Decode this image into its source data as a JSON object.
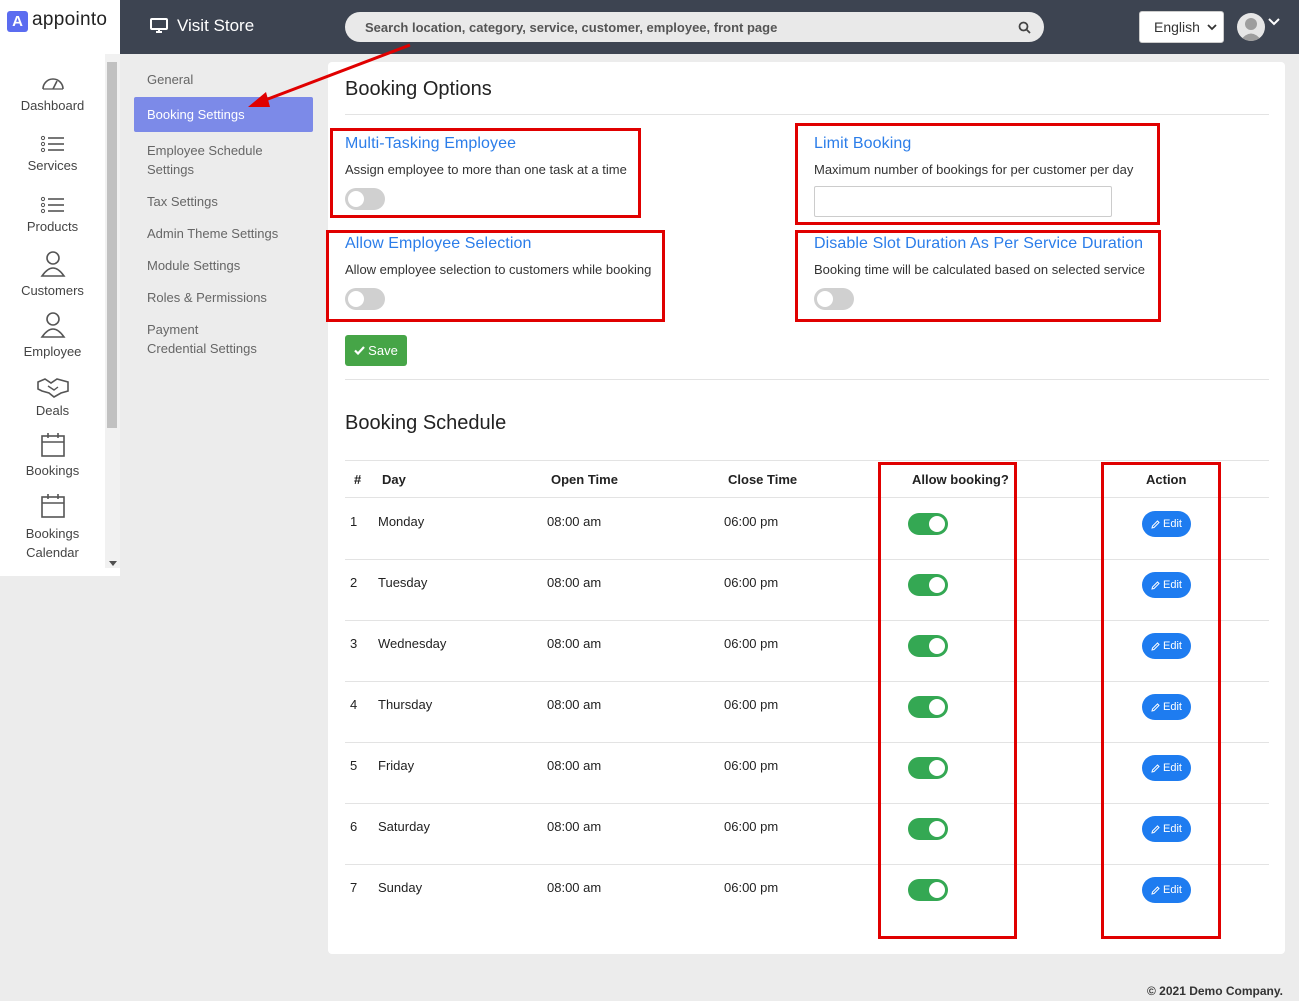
{
  "app": {
    "name": "appointo",
    "logo_letter": "A"
  },
  "topbar": {
    "visit_store": "Visit Store",
    "search_placeholder": "Search location, category, service, customer, employee, front page",
    "language": "English"
  },
  "sidebar": {
    "items": [
      {
        "label": "Dashboard",
        "icon": "dashboard-gauge-icon"
      },
      {
        "label": "Services",
        "icon": "list-icon"
      },
      {
        "label": "Products",
        "icon": "list-icon"
      },
      {
        "label": "Customers",
        "icon": "user-icon"
      },
      {
        "label": "Employee",
        "icon": "user-icon"
      },
      {
        "label": "Deals",
        "icon": "handshake-icon"
      },
      {
        "label": "Bookings",
        "icon": "calendar-icon"
      },
      {
        "label": "Bookings Calendar",
        "icon": "calendar-icon"
      }
    ]
  },
  "settings_menu": [
    "General",
    "Booking Settings",
    "Employee Schedule Settings",
    "Tax Settings",
    "Admin Theme Settings",
    "Module Settings",
    "Roles & Permissions",
    "Payment Credential Settings"
  ],
  "booking_options": {
    "title": "Booking Options",
    "multi_tasking": {
      "title": "Multi-Tasking Employee",
      "desc": "Assign employee to more than one task at a time"
    },
    "limit_booking": {
      "title": "Limit Booking",
      "desc": "Maximum number of bookings for per customer per day",
      "value": ""
    },
    "employee_selection": {
      "title": "Allow Employee Selection",
      "desc": "Allow employee selection to customers while booking"
    },
    "disable_slot": {
      "title": "Disable Slot Duration As Per Service Duration",
      "desc": "Booking time will be calculated based on selected service"
    },
    "save_label": "Save"
  },
  "booking_schedule": {
    "title": "Booking Schedule",
    "columns": {
      "num": "#",
      "day": "Day",
      "open": "Open Time",
      "close": "Close Time",
      "allow": "Allow booking?",
      "action": "Action"
    },
    "edit_label": "Edit",
    "rows": [
      {
        "num": "1",
        "day": "Monday",
        "open": "08:00 am",
        "close": "06:00 pm"
      },
      {
        "num": "2",
        "day": "Tuesday",
        "open": "08:00 am",
        "close": "06:00 pm"
      },
      {
        "num": "3",
        "day": "Wednesday",
        "open": "08:00 am",
        "close": "06:00 pm"
      },
      {
        "num": "4",
        "day": "Thursday",
        "open": "08:00 am",
        "close": "06:00 pm"
      },
      {
        "num": "5",
        "day": "Friday",
        "open": "08:00 am",
        "close": "06:00 pm"
      },
      {
        "num": "6",
        "day": "Saturday",
        "open": "08:00 am",
        "close": "06:00 pm"
      },
      {
        "num": "7",
        "day": "Sunday",
        "open": "08:00 am",
        "close": "06:00 pm"
      }
    ]
  },
  "footer": "© 2021 Demo Company.",
  "colors": {
    "accent": "#7c8ae8",
    "link": "#2b7de9",
    "success": "#46a547",
    "annotation": "#e00000"
  }
}
